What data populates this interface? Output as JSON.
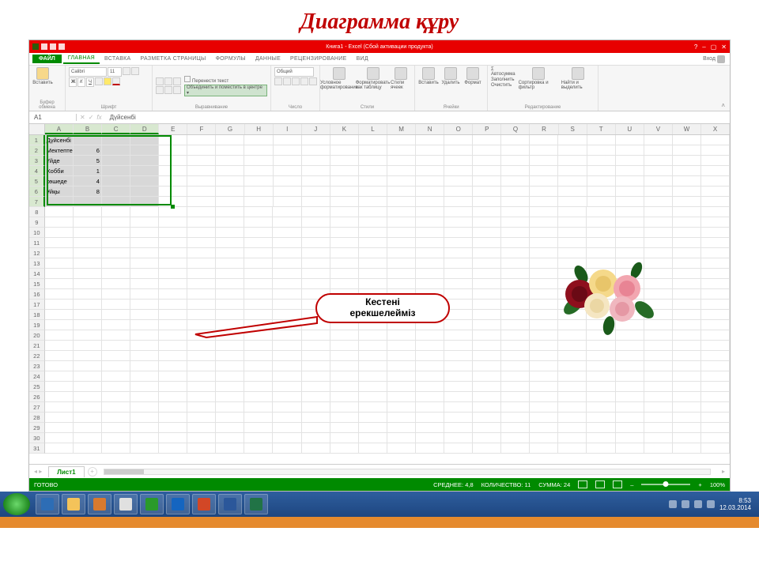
{
  "page_title": "Диаграмма құру",
  "callout_text": "Кестені\nерекшелейміз",
  "titlebar": {
    "text": "Книга1 - Excel (Сбой активации продукта)",
    "min": "–",
    "max": "▢",
    "close": "✕",
    "help": "?"
  },
  "tabs": {
    "file": "ФАЙЛ",
    "items": [
      "ГЛАВНАЯ",
      "ВСТАВКА",
      "РАЗМЕТКА СТРАНИЦЫ",
      "ФОРМУЛЫ",
      "ДАННЫЕ",
      "РЕЦЕНЗИРОВАНИЕ",
      "ВИД"
    ],
    "signin": "Вход"
  },
  "ribbon": {
    "clipboard": {
      "label": "Буфер обмена",
      "paste": "Вставить"
    },
    "font": {
      "label": "Шрифт",
      "name": "Calibri",
      "size": "11",
      "bold": "Ж",
      "italic": "К",
      "underline": "Ч"
    },
    "alignment": {
      "label": "Выравнивание",
      "wrap": "Перенести текст",
      "merge": "Объединить и поместить в центре"
    },
    "number": {
      "label": "Число",
      "format": "Общий"
    },
    "styles": {
      "label": "Стили",
      "cond": "Условное форматирование",
      "table": "Форматировать как таблицу",
      "cell": "Стили ячеек"
    },
    "cells": {
      "label": "Ячейки",
      "insert": "Вставить",
      "delete": "Удалить",
      "format": "Формат"
    },
    "editing": {
      "label": "Редактирование",
      "autosum": "Σ Автосумма",
      "fill": "Заполнить",
      "clear": "Очистить",
      "sort": "Сортировка и фильтр",
      "find": "Найти и выделить"
    }
  },
  "namebox": "A1",
  "formula": "Дүйсенбі",
  "columns": [
    "A",
    "B",
    "C",
    "D",
    "E",
    "F",
    "G",
    "H",
    "I",
    "J",
    "K",
    "L",
    "M",
    "N",
    "O",
    "P",
    "Q",
    "R",
    "S",
    "T",
    "U",
    "V",
    "W",
    "X"
  ],
  "sel_cols": [
    "A",
    "B",
    "C",
    "D"
  ],
  "sel_rownums": [
    1,
    2,
    3,
    4,
    5,
    6,
    7
  ],
  "table_rows": [
    {
      "a": "Дүйсенбі",
      "b": ""
    },
    {
      "a": "Мектепте",
      "b": "6"
    },
    {
      "a": "Үйде",
      "b": "5"
    },
    {
      "a": "Хобби",
      "b": "1"
    },
    {
      "a": "көшеде",
      "b": "4"
    },
    {
      "a": "Ұйқы",
      "b": "8"
    },
    {
      "a": "",
      "b": ""
    }
  ],
  "total_rows": 31,
  "sheet_tab": "Лист1",
  "statusbar": {
    "ready": "ГОТОВО",
    "avg_label": "СРЕДНЕЕ:",
    "avg": "4,8",
    "count_label": "КОЛИЧЕСТВО:",
    "count": "11",
    "sum_label": "СУММА:",
    "sum": "24",
    "zoom": "100%"
  },
  "tray": {
    "time": "8:53",
    "date": "12.03.2014"
  },
  "taskbar_apps": [
    {
      "name": "ie",
      "color": "#2d6db5"
    },
    {
      "name": "explorer",
      "color": "#f4c35a"
    },
    {
      "name": "player",
      "color": "#d97a2f"
    },
    {
      "name": "chrome",
      "color": "#e0e0e0"
    },
    {
      "name": "app-green",
      "color": "#2a9a2a"
    },
    {
      "name": "outlook",
      "color": "#1565c0"
    },
    {
      "name": "powerpoint",
      "color": "#d24726"
    },
    {
      "name": "word",
      "color": "#2b579a"
    },
    {
      "name": "excel",
      "color": "#217346"
    }
  ]
}
